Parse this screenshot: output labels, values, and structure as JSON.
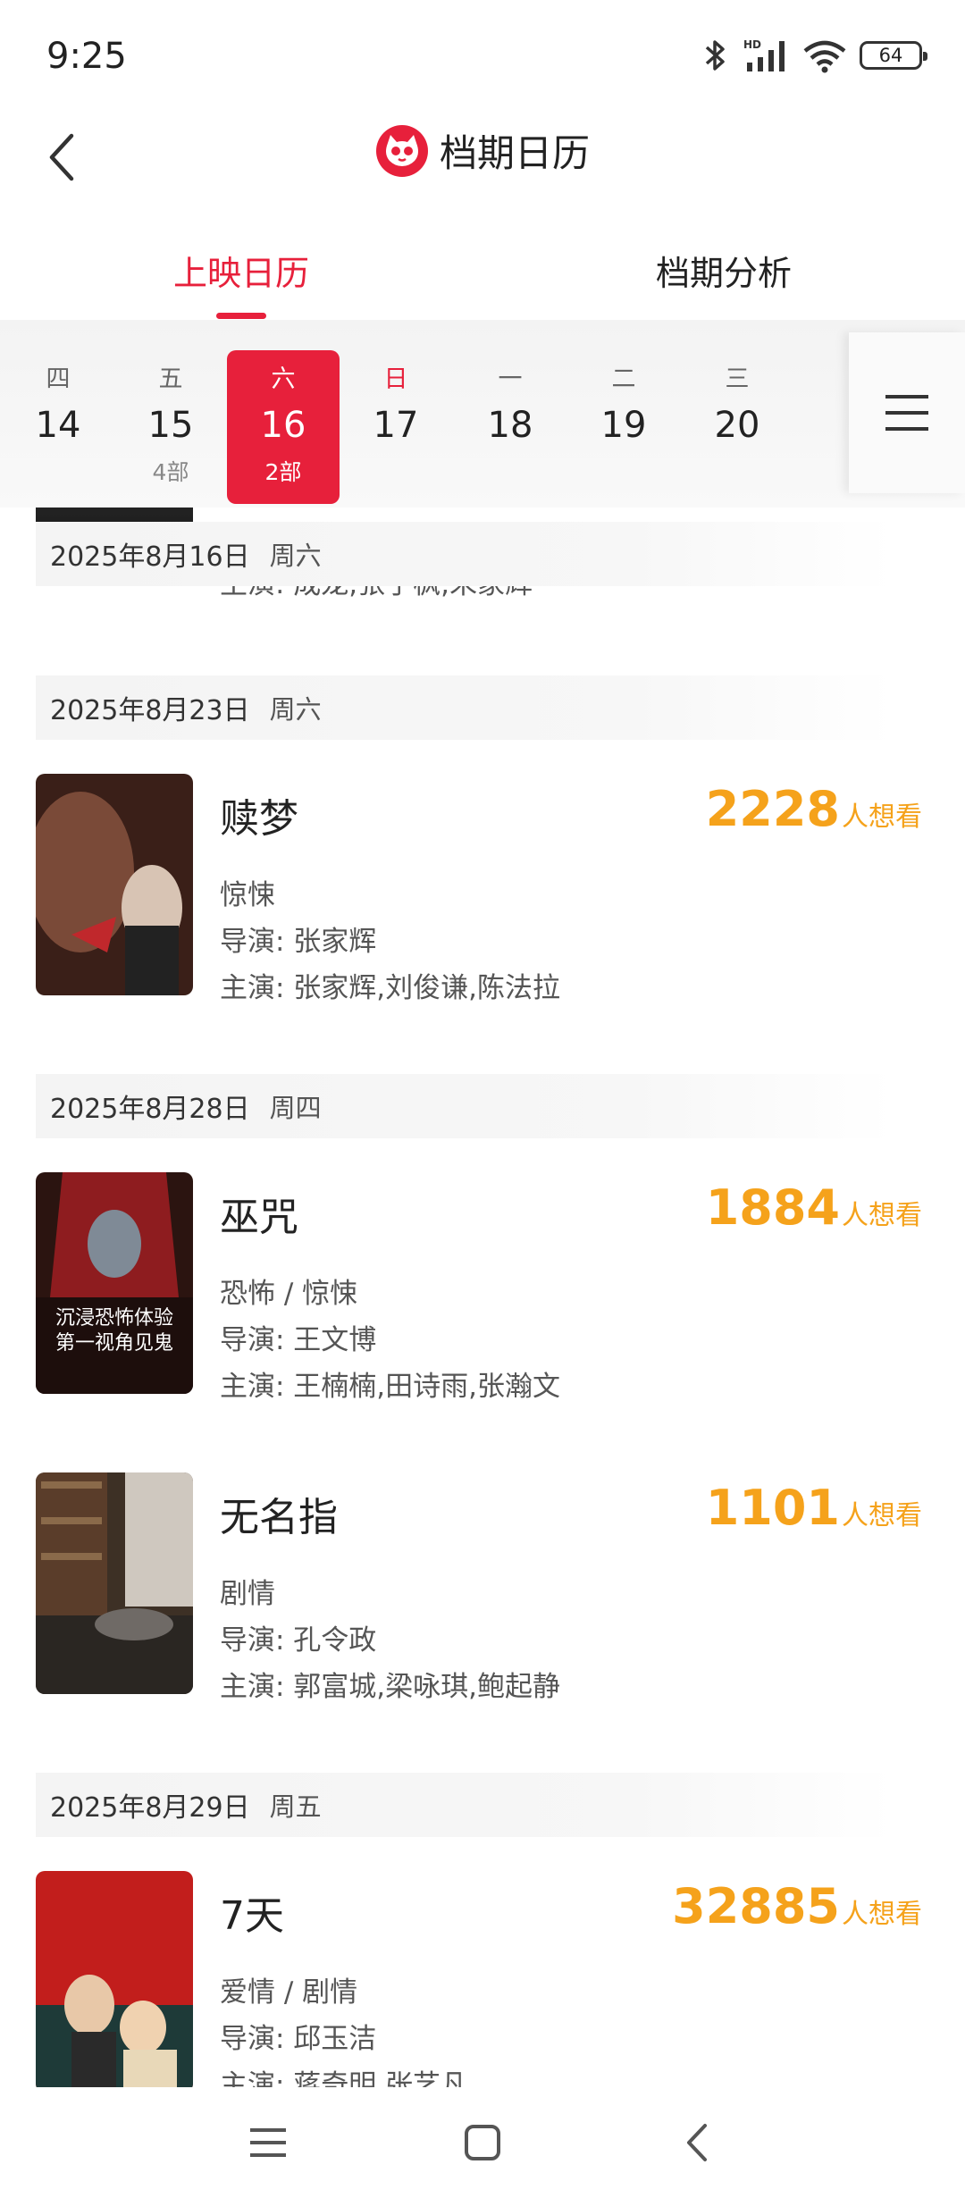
{
  "status": {
    "time": "9:25",
    "battery": "64",
    "network": "HD",
    "icons": [
      "bluetooth-icon",
      "signal-icon",
      "wifi-icon",
      "battery-icon"
    ]
  },
  "header": {
    "title": "档期日历",
    "logo": "cat-eye-logo",
    "back_icon": "back-arrow-icon"
  },
  "tabs": [
    {
      "label": "上映日历",
      "active": true
    },
    {
      "label": "档期分析",
      "active": false
    }
  ],
  "calendar": {
    "days": [
      {
        "week": "四",
        "num": "14",
        "count": ""
      },
      {
        "week": "五",
        "num": "15",
        "count": "4部"
      },
      {
        "week": "六",
        "num": "16",
        "count": "2部",
        "selected": true
      },
      {
        "week": "日",
        "num": "17",
        "count": ""
      },
      {
        "week": "一",
        "num": "18",
        "count": ""
      },
      {
        "week": "二",
        "num": "19",
        "count": ""
      },
      {
        "week": "三",
        "num": "20",
        "count": ""
      }
    ],
    "menu_icon": "hamburger-menu-icon"
  },
  "list": {
    "sticky_date": {
      "date": "2025年8月16日",
      "weekday": "周六"
    },
    "partial_cast": "主演: 成龙,张子枫,朱家辉",
    "groups": [
      {
        "date": "2025年8月23日",
        "weekday": "周六",
        "movies": [
          {
            "title": "赎梦",
            "want_num": "2228",
            "want_label": "人想看",
            "genre": "惊悚",
            "director": "导演: 张家辉",
            "cast": "主演: 张家辉,刘俊谦,陈法拉"
          }
        ]
      },
      {
        "date": "2025年8月28日",
        "weekday": "周四",
        "movies": [
          {
            "title": "巫咒",
            "want_num": "1884",
            "want_label": "人想看",
            "genre": "恐怖 / 惊悚",
            "director": "导演: 王文博",
            "cast": "主演: 王楠楠,田诗雨,张瀚文",
            "poster_text": [
              "沉浸恐怖体验",
              "第一视角见鬼"
            ]
          },
          {
            "title": "无名指",
            "want_num": "1101",
            "want_label": "人想看",
            "genre": "剧情",
            "director": "导演: 孔令政",
            "cast": "主演: 郭富城,梁咏琪,鲍起静"
          }
        ]
      },
      {
        "date": "2025年8月29日",
        "weekday": "周五",
        "movies": [
          {
            "title": "7天",
            "want_num": "32885",
            "want_label": "人想看",
            "genre": "爱情 / 剧情",
            "director": "导演: 邱玉洁",
            "cast": "主演: 蒋奇明,张艺凡"
          }
        ]
      }
    ]
  },
  "accent_color": "#e7203b",
  "want_color": "#f5a21b"
}
